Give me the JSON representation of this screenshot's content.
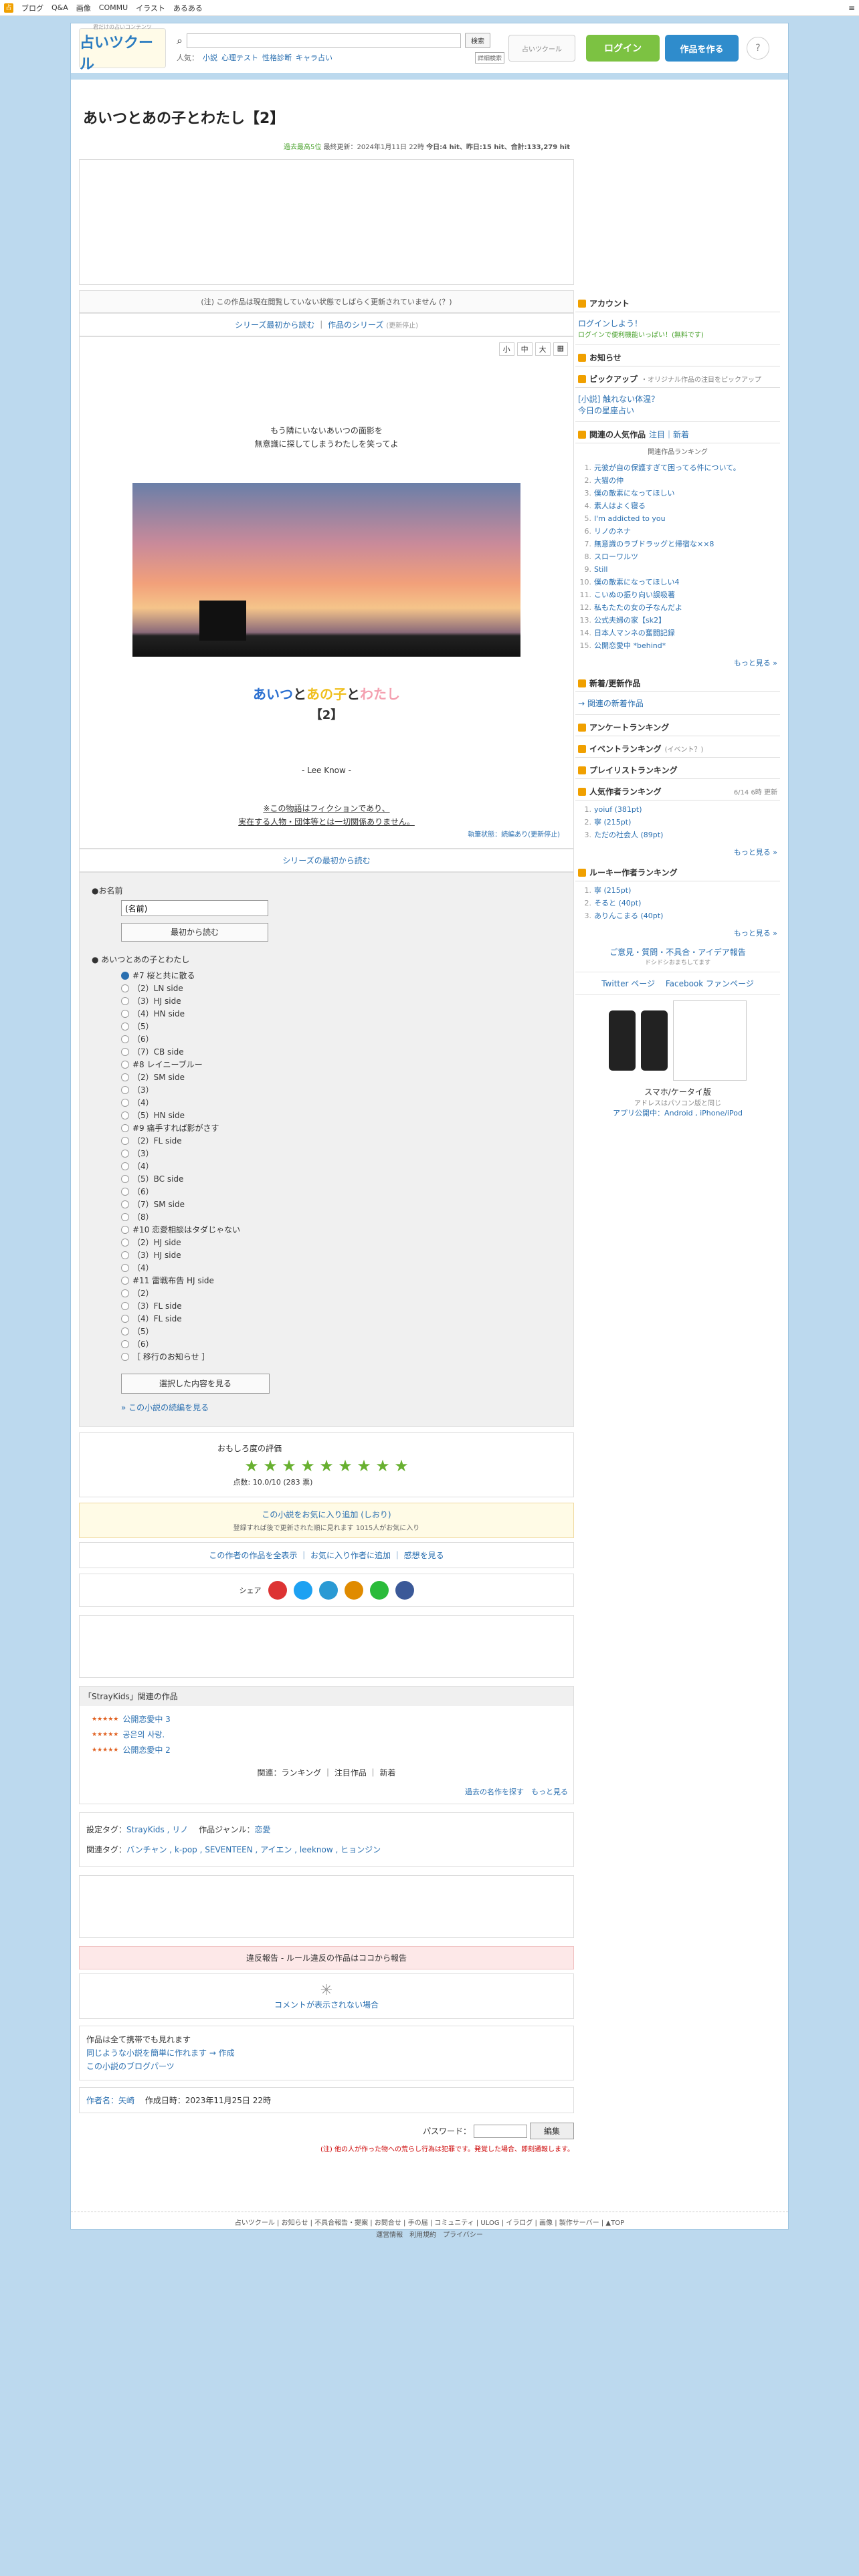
{
  "topbar": {
    "items": [
      "ブログ",
      "Q&A",
      "画像",
      "COMMU",
      "イラスト",
      "あるある"
    ],
    "menu": "≡"
  },
  "header": {
    "logo_name": "占いツクール",
    "logo_tag": "君だけの占いコンテンツ",
    "search_button": "検索",
    "popular_label": "人気：",
    "popular": [
      "小説",
      "心理テスト",
      "性格診断",
      "キャラ占い"
    ],
    "detail_search": "詳細検索",
    "badge": "占いツクール",
    "login": "ログイン",
    "create": "作品を作る",
    "help": "?"
  },
  "main": {
    "title": "あいつとあの子とわたし【2】",
    "meta_status": "過去最高5位",
    "meta_updated": "最終更新：2024年1月11日 22時",
    "meta_counts": "今日:4 hit、昨日:15 hit、合計:133,279 hit",
    "notice": "(注) この作品は現在閲覧していない状態でしばらく更新されていません (？)",
    "series_read": "シリーズ最初から読む",
    "series_sep": "｜",
    "series_works": "作品のシリーズ",
    "series_note": "(更新停止)",
    "font_sizes": [
      "小",
      "中",
      "大"
    ],
    "lead_line1": "もう隣にいないあいつの面影を",
    "lead_line2": "無意識に探してしまうわたしを笑ってよ",
    "story_title_a": "あいつ",
    "story_title_b": "と",
    "story_title_c": "あの子",
    "story_title_d": "と",
    "story_title_e": "わたし",
    "story_sub": "【2】",
    "author_sig": "- Lee Know -",
    "disclaimer1": "※この物語はフィクションであり、",
    "disclaimer2": "実在する人物・団体等とは一切関係ありません。",
    "status_line": "執筆状態：続編あり(更新停止)",
    "series_first": "シリーズの最初から読む",
    "name_label": "●お名前",
    "name_placeholder": "(名前)",
    "read_first": "最初から読む",
    "chapter_title": "● あいつとあの子とわたし",
    "chapters": [
      "#7 桜と共に散る",
      "（2）LN side",
      "（3）HJ side",
      "（4）HN side",
      "（5）",
      "（6）",
      "（7）CB side",
      "#8 レイニーブルー",
      "（2）SM side",
      "（3）",
      "（4）",
      "（5）HN side",
      "#9 痛手すれば影がさす",
      "（2）FL side",
      "（3）",
      "（4）",
      "（5）BC side",
      "（6）",
      "（7）SM side",
      "（8）",
      "#10 恋愛相談はタダじゃない",
      "（2）HJ side",
      "（3）HJ side",
      "（4）",
      "#11 雷戦布告 HJ side",
      "（2）",
      "（3）FL side",
      "（4）FL side",
      "（5）",
      "（6）",
      "［ 移行のお知らせ ］"
    ],
    "view_selected": "選択した内容を見る",
    "first_link": "» この小説の続編を見る",
    "rating_label": "おもしろ度の評価",
    "star_count": 9,
    "score": "点数: 10.0/10 (283 票)",
    "fav_add": "この小説をお気に入り追加 (しおり)",
    "fav_note": "登録すれば後で更新された順に見れます 1015人がお気に入り",
    "act_all": "この作者の作品を全表示",
    "act_fav": "お気に入り作者に追加",
    "act_review": "感想を見る",
    "share_label": "シェア",
    "share_icons": [
      {
        "name": "mail",
        "color": "#d33"
      },
      {
        "name": "twitter",
        "color": "#1da1f2"
      },
      {
        "name": "hatena",
        "color": "#2a9ad4"
      },
      {
        "name": "mixi",
        "color": "#e08b00"
      },
      {
        "name": "line",
        "color": "#2abb3a"
      },
      {
        "name": "facebook",
        "color": "#3b5998"
      }
    ],
    "related_title": "「StrayKids」関連の作品",
    "related": [
      {
        "rating": "★★★★★",
        "title": "公開恋愛中 3"
      },
      {
        "rating": "★★★★★",
        "title": "공은의 사랑."
      },
      {
        "rating": "★★★★★",
        "title": "公開恋愛中 2"
      }
    ],
    "rel_footer": "関連：ランキング ｜ 注目作品 ｜ 新着",
    "rel_more": "過去の名作を探す　もっと見る",
    "tags_set_label": "設定タグ：",
    "tags_set": "StrayKids , リノ",
    "tags_genre_label": "作品ジャンル：",
    "tags_genre": "恋愛",
    "tags_rel_label": "関連タグ：",
    "tags_rel": "バンチャン , k-pop , SEVENTEEN , アイエン , leeknow , ヒョンジン",
    "report": "違反報告 - ルール違反の作品はココから報告",
    "comments": "コメントが表示されない場合",
    "misc1": "作品は全て携帯でも見れます",
    "misc2": "同じような小説を簡単に作れます → 作成",
    "misc3": "この小説のブログパーツ",
    "byline_author": "作者名：矢崎",
    "byline_date": "作成日時：2023年11月25日 22時",
    "pw_label": "パスワード：",
    "edit": "編集",
    "warn": "(注) 他の人が作った物への荒らし行為は犯罪です。発覚した場合、即刻通報します。"
  },
  "side": {
    "account": "アカウント",
    "login_msg": "ログインしよう！",
    "login_sub": "ログインで便利機能いっぱい！(無料です)",
    "notice": "お知らせ",
    "pickup": "ピックアップ",
    "pickup_sub": "・オリジナル作品の注目をピックアップ",
    "pickup_item1": "[小説] 触れない体温？",
    "pickup_item2": "今日の星座占い",
    "ranking_head": "関連の人気作品",
    "ranking_tabs": "注目｜新着",
    "ranking_sub": "関連作品ランキング",
    "ranking": [
      "元彼が自の保護すぎて困ってる件について。",
      "大猫の仲",
      "僕の敵素になってほしい",
      "素人はよく寝る",
      "I'm addicted to you",
      "リノのネナ",
      "無意識のラブドラッグと帰宿な××8",
      "スローワルツ",
      "Still",
      "僕の敵素になってほしい4",
      "こいぬの振り向い誤吸著",
      "私もたたの女の子なんだよ",
      "公式夫婦の家【sk2】",
      "日本人マンネの奮闘記録",
      "公開恋愛中 *behind*"
    ],
    "more": "もっと見る »",
    "new_head": "新着/更新作品",
    "new_link": "→ 関連の新着作品",
    "enquete": "アンケートランキング",
    "event": "イベントランキング",
    "event_sub": "(イベント？)",
    "play": "プレイリストランキング",
    "pop_author": "人気作者ランキング",
    "pop_date": "6/14 6時 更新",
    "pop_authors": [
      "yoiuf (381pt)",
      "寧 (215pt)",
      "ただの社会人 (89pt)"
    ],
    "rookie": "ルーキー作者ランキング",
    "rookies": [
      "寧 (215pt)",
      "そると (40pt)",
      "ありんこまる (40pt)"
    ],
    "feedback": "ご意見・質問・不具合・アイデア報告",
    "feedback_sub": "ドシドシおまちしてます",
    "twitter": "Twitter ページ",
    "facebook": "Facebook ファンページ",
    "mobile": "スマホ/ケータイ版",
    "mobile_sub": "アドレスはパソコン版と同じ",
    "app": "アプリ公開中：Android , iPhone/iPod"
  },
  "footer": {
    "line1": "占いツクール | お知らせ | 不具合報告・提案 | お問合せ | 手の届 | コミュニティ | ULOG | イラログ | 画像 | 製作サーバー | ▲TOP",
    "line2": "運営情報　利用規約　プライバシー"
  }
}
